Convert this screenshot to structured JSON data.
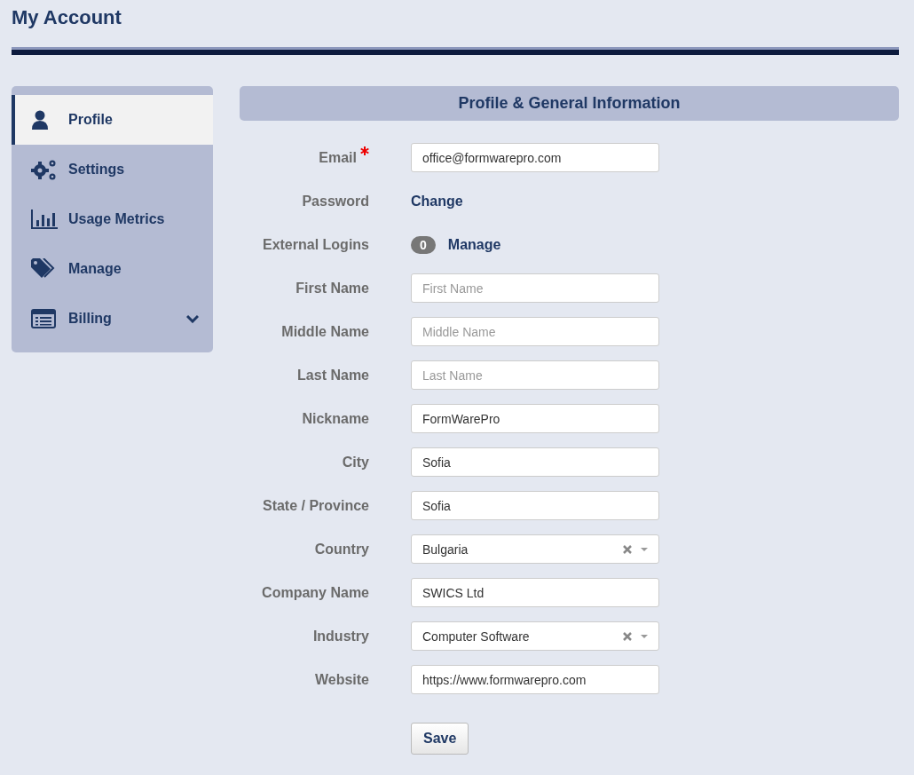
{
  "page_title": "My Account",
  "sidebar": {
    "items": [
      {
        "label": "Profile",
        "selected": true
      },
      {
        "label": "Settings",
        "selected": false
      },
      {
        "label": "Usage Metrics",
        "selected": false
      },
      {
        "label": "Manage",
        "selected": false
      },
      {
        "label": "Billing",
        "selected": false,
        "expandable": true
      }
    ]
  },
  "panel": {
    "title": "Profile & General Information",
    "fields": [
      {
        "kind": "input",
        "label": "Email",
        "required": true,
        "value": "office@formwarepro.com"
      },
      {
        "kind": "link",
        "label": "Password",
        "link": "Change"
      },
      {
        "kind": "logins",
        "label": "External Logins",
        "count": "0",
        "link": "Manage"
      },
      {
        "kind": "input",
        "label": "First Name",
        "placeholder": "First Name"
      },
      {
        "kind": "input",
        "label": "Middle Name",
        "placeholder": "Middle Name"
      },
      {
        "kind": "input",
        "label": "Last Name",
        "placeholder": "Last Name"
      },
      {
        "kind": "input",
        "label": "Nickname",
        "value": "FormWarePro"
      },
      {
        "kind": "input",
        "label": "City",
        "value": "Sofia"
      },
      {
        "kind": "input",
        "label": "State / Province",
        "value": "Sofia"
      },
      {
        "kind": "select",
        "label": "Country",
        "value": "Bulgaria"
      },
      {
        "kind": "input",
        "label": "Company Name",
        "value": "SWICS Ltd"
      },
      {
        "kind": "select",
        "label": "Industry",
        "value": "Computer Software"
      },
      {
        "kind": "input",
        "label": "Website",
        "value": "https://www.formwarepro.com"
      }
    ],
    "save_button": "Save"
  }
}
